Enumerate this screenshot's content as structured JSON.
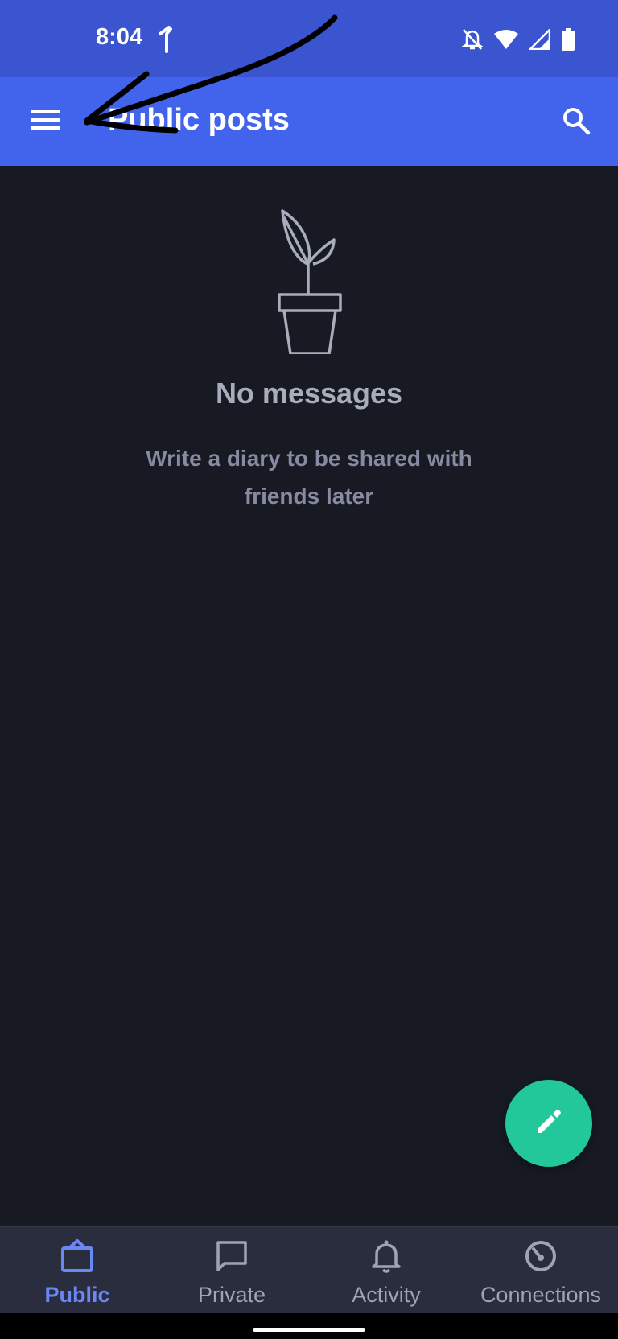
{
  "status_bar": {
    "time": "8:04",
    "icons": [
      "navigation-arrow-icon",
      "bell-off-icon",
      "wifi-icon",
      "signal-icon",
      "battery-icon"
    ]
  },
  "app_bar": {
    "title": "Public posts",
    "menu_icon": "menu-icon",
    "search_icon": "search-icon",
    "background": "#4264ec"
  },
  "empty_state": {
    "illustration": "plant-pot-icon",
    "title": "No messages",
    "subtitle": "Write a diary to be shared with friends later"
  },
  "fab": {
    "icon": "pencil-icon",
    "color": "#22c89a"
  },
  "bottom_nav": {
    "items": [
      {
        "label": "Public",
        "icon": "bag-icon",
        "active": true
      },
      {
        "label": "Private",
        "icon": "chat-icon",
        "active": false
      },
      {
        "label": "Activity",
        "icon": "bell-icon",
        "active": false
      },
      {
        "label": "Connections",
        "icon": "gauge-icon",
        "active": false
      }
    ],
    "active_color": "#6a87f6"
  },
  "annotation": {
    "type": "hand-drawn-arrow",
    "points_to": "menu-icon",
    "color": "#000000"
  }
}
